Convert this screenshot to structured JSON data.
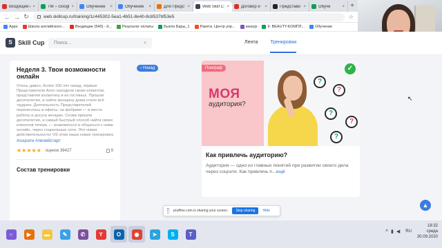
{
  "browser": {
    "tabs": [
      {
        "label": "Входящие (",
        "color": "#d93025",
        "active": false
      },
      {
        "label": "TM – Googl",
        "color": "#0f9d58",
        "active": false
      },
      {
        "label": "Обучение ",
        "color": "#4285f4",
        "active": false
      },
      {
        "label": "Обучение ",
        "color": "#4285f4",
        "active": false
      },
      {
        "label": "Для Предст",
        "color": "#e8710a",
        "active": false
      },
      {
        "label": "Web Skill C",
        "color": "#3b4252",
        "active": true
      },
      {
        "label": "Договор и ",
        "color": "#d93025",
        "active": false
      },
      {
        "label": "Представи",
        "color": "#222222",
        "active": false
      },
      {
        "label": "Обуче",
        "color": "#0f9d58",
        "active": false
      }
    ],
    "tab_close": "×",
    "new_tab": "+",
    "address": "web.skillcup.ru/training/1c445302-5ea1-4b51-8e40-8c8537bf53e5",
    "bookmarks": [
      {
        "label": "Apps",
        "color": "#4285f4"
      },
      {
        "label": "Школа английского...",
        "color": "#e53935"
      },
      {
        "label": "Входящие (540) - d...",
        "color": "#d93025"
      },
      {
        "label": "Результат оплаты",
        "color": "#43a047"
      },
      {
        "label": "Бьюти Бары_1",
        "color": "#0f9d58"
      },
      {
        "label": "Ракета. Центр упр...",
        "color": "#f4511e"
      },
      {
        "label": "канкур",
        "color": "#7e57c2"
      },
      {
        "label": "9. BEAUTY-КОМПЛ...",
        "color": "#0f9d58"
      },
      {
        "label": "Обучение",
        "color": "#4285f4"
      }
    ]
  },
  "site": {
    "logo_mark": "S",
    "logo_text": "Skill Cup",
    "search_placeholder": "Поиск...",
    "nav": {
      "feed": "Лента",
      "trainings": "Тренировки"
    },
    "back_label": "Назад"
  },
  "training": {
    "title": "Неделя 3. Твои возможности онлайн",
    "description": "Очень давно, более 100 лет назад, первые Представители Avon находили своих клиентов, представляя косметику в их гостиных. Прошли десятилетия, и найти женщину дома стало всё труднее. Деятельность Представителей перенеслась в офисы, на фабрики — в места работы и досуга женщин. Снова прошли десятилетия, и самый быстрый способ найти своих клиентов теперь — знакомиться и общаться с ними онлайн, через социальные сети. Это новая действительность! Об этом наша новая тренировка",
    "hashtags": "#соцсети #легкийстарт",
    "stars": "★★★★★",
    "rating_label": "оценок 39427",
    "copies": "9",
    "section_title": "Состав тренировки"
  },
  "lesson": {
    "badge": "Понграф",
    "hero_title": "МОЯ",
    "hero_subtitle": "аудитория?",
    "check_symbol": "✓",
    "title": "Как привлечь аудиторию?",
    "text": "Аудитория — одно из главных понятий при развитии своего дела через соцсети. Как привлечь п...",
    "read_more": "ещё"
  },
  "share_banner": {
    "message": "pruffme.com is sharing your screen.",
    "stop_label": "Stop sharing",
    "hide_label": "Hide"
  },
  "taskbar": {
    "apps": [
      {
        "name": "cortana-icon",
        "color": "#7b5cd6",
        "glyph": "○"
      },
      {
        "name": "media-player-icon",
        "color": "#e8710a",
        "glyph": "▶"
      },
      {
        "name": "file-explorer-icon",
        "color": "#f2c744",
        "glyph": "▬"
      },
      {
        "name": "paint-icon",
        "color": "#3aa0e8",
        "glyph": "✎"
      },
      {
        "name": "viber-icon",
        "color": "#7b519d",
        "glyph": "✆"
      },
      {
        "name": "yandex-icon",
        "color": "#e53935",
        "glyph": "Y"
      },
      {
        "name": "outlook-icon",
        "color": "#0a64ad",
        "glyph": "O"
      },
      {
        "name": "chrome-icon",
        "color": "#db4437",
        "glyph": "◉"
      },
      {
        "name": "telegram-icon",
        "color": "#2aa3df",
        "glyph": "➤"
      },
      {
        "name": "skype-icon",
        "color": "#00aff0",
        "glyph": "S"
      },
      {
        "name": "teams-icon",
        "color": "#5b5fc7",
        "glyph": "T"
      }
    ],
    "lang": "RU",
    "time": "18:32",
    "weekday": "среда",
    "date": "30.09.2020"
  }
}
